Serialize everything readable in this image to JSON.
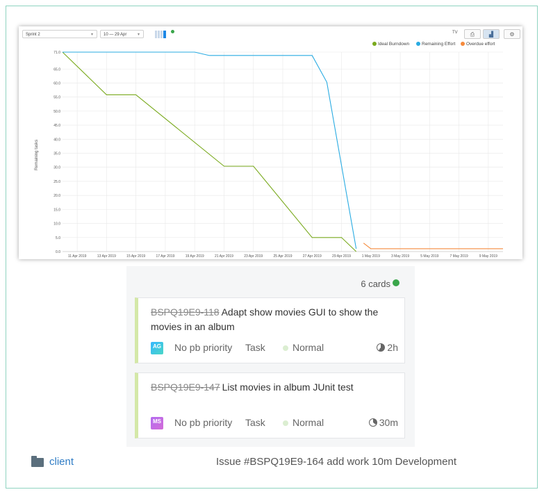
{
  "toolbar": {
    "sprint_select": "Sprint 2",
    "range_select": "10 — 29 Apr",
    "tv_label": "TV",
    "view_buttons": [
      {
        "icon": "print-icon",
        "active": false
      },
      {
        "icon": "chart-icon",
        "active": true
      },
      {
        "icon": "gear-icon",
        "active": false
      }
    ]
  },
  "colors": {
    "ideal": "#7aaa1e",
    "remaining": "#29abe2",
    "overdue": "#f58a3c",
    "grid": "#e8e8e8"
  },
  "chart_data": {
    "type": "line",
    "ylabel": "Remaining tasks",
    "ylim": [
      0,
      71
    ],
    "yticks": [
      "0.0",
      "5.0",
      "10.0",
      "15.0",
      "20.0",
      "25.0",
      "30.0",
      "35.0",
      "40.0",
      "45.0",
      "50.0",
      "55.0",
      "60.0",
      "65.0",
      "71.0"
    ],
    "x_tick_labels": [
      "11 Apr 2019",
      "13 Apr 2019",
      "15 Apr 2019",
      "17 Apr 2019",
      "19 Apr 2019",
      "21 Apr 2019",
      "23 Apr 2019",
      "25 Apr 2019",
      "27 Apr 2019",
      "29 Apr 2019",
      "1 May 2019",
      "3 May 2019",
      "5 May 2019",
      "7 May 2019",
      "9 May 2019"
    ],
    "x_tick_days": [
      1,
      3,
      5,
      7,
      9,
      11,
      13,
      15,
      17,
      19,
      21,
      23,
      25,
      27,
      29
    ],
    "xlim_days": [
      0,
      30
    ],
    "grid": true,
    "legend_position": "top-right",
    "series": [
      {
        "name": "Ideal Burndown",
        "color": "#7aaa1e",
        "x": [
          0,
          3,
          5,
          11,
          13,
          17,
          19,
          20
        ],
        "y": [
          71,
          55.8,
          55.8,
          30.4,
          30.4,
          5,
          5,
          0
        ]
      },
      {
        "name": "Remaining Effort",
        "color": "#29abe2",
        "x": [
          0,
          9,
          10,
          17,
          18,
          20
        ],
        "y": [
          71,
          71,
          69.8,
          69.8,
          60.3,
          1
        ]
      },
      {
        "name": "Overdue effort",
        "color": "#f58a3c",
        "x": [
          20.5,
          21,
          30
        ],
        "y": [
          3,
          1,
          1
        ]
      }
    ]
  },
  "board": {
    "count_label": "6 cards",
    "cards": [
      {
        "key": "BSPQ19E9-118",
        "title": "Adapt show movies GUI to show the movies in an album",
        "avatar": "AG",
        "priority": "No pb priority",
        "type": "Task",
        "severity": "Normal",
        "time": "2h",
        "time_fill": 60
      },
      {
        "key": "BSPQ19E9-147",
        "title": "List movies in album JUnit test",
        "avatar": "MS",
        "priority": "No pb priority",
        "type": "Task",
        "severity": "Normal",
        "time": "30m",
        "time_fill": 35
      }
    ]
  },
  "footer": {
    "folder": "client",
    "commit_message": "Issue #BSPQ19E9-164 add work 10m Development"
  }
}
